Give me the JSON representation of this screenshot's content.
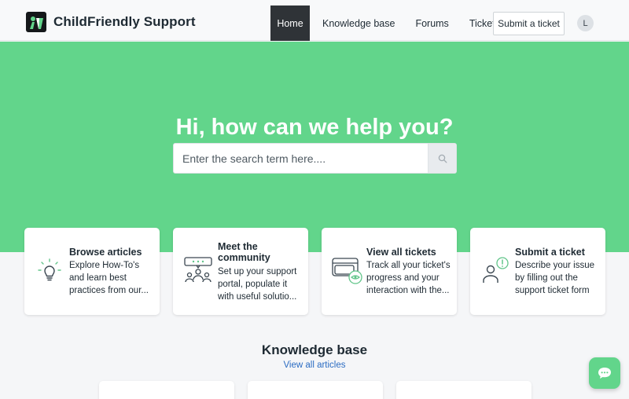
{
  "header": {
    "brand": "ChildFriendly Support",
    "nav": [
      "Home",
      "Knowledge base",
      "Forums",
      "Tickets"
    ],
    "submit_label": "Submit a ticket",
    "avatar_initial": "L"
  },
  "hero": {
    "title": "Hi, how can we help you?",
    "search_placeholder": "Enter the search term here....",
    "background": "#62d58b"
  },
  "cards": [
    {
      "title": "Browse articles",
      "desc": "Explore How-To's and learn best practices from our...",
      "icon": "lightbulb-icon"
    },
    {
      "title": "Meet the community",
      "desc": "Set up your support portal, populate it with useful solutio...",
      "icon": "community-icon"
    },
    {
      "title": "View all tickets",
      "desc": "Track all your ticket's progress and your interaction with the...",
      "icon": "tickets-icon"
    },
    {
      "title": "Submit a ticket",
      "desc": "Describe your issue by filling out the support ticket form",
      "icon": "submit-ticket-icon"
    }
  ],
  "knowledge_base": {
    "title": "Knowledge base",
    "link": "View all articles"
  },
  "colors": {
    "accent": "#62d58b",
    "link": "#2b6cc2",
    "nav_active": "#2f3337"
  }
}
